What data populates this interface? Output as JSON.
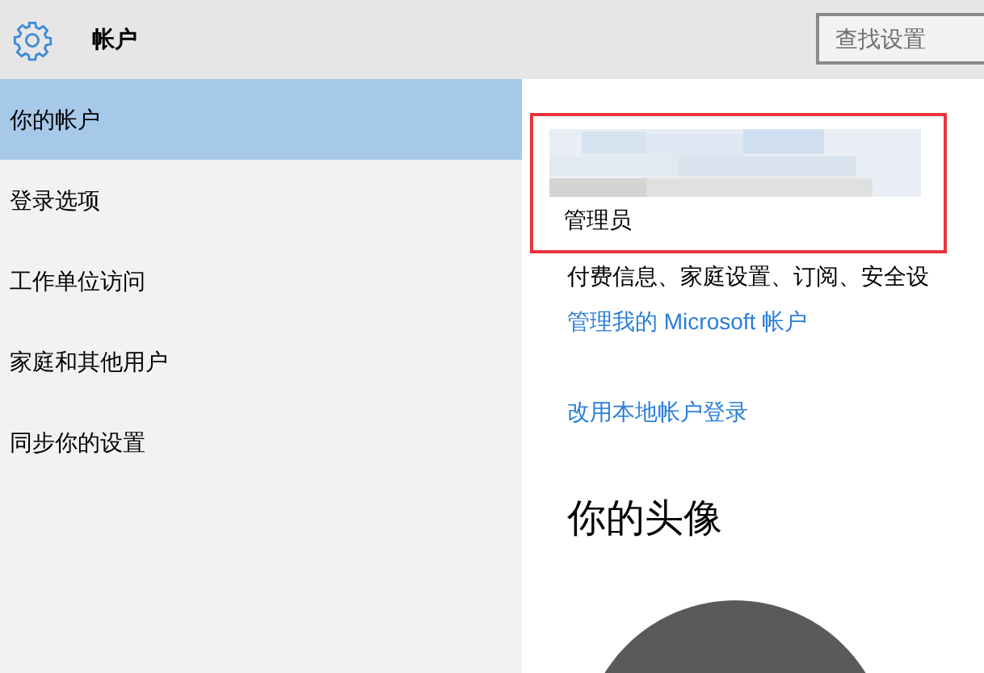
{
  "header": {
    "title": "帐户",
    "search": {
      "placeholder": "查找设置"
    }
  },
  "sidebar": {
    "items": [
      {
        "label": "你的帐户",
        "selected": true
      },
      {
        "label": "登录选项",
        "selected": false
      },
      {
        "label": "工作单位访问",
        "selected": false
      },
      {
        "label": "家庭和其他用户",
        "selected": false
      },
      {
        "label": "同步你的设置",
        "selected": false
      }
    ]
  },
  "account": {
    "highlighted": true,
    "role": "管理员"
  },
  "content": {
    "description": "付费信息、家庭设置、订阅、安全设",
    "links": [
      "管理我的 Microsoft 帐户",
      "改用本地帐户登录"
    ],
    "avatar_heading": "你的头像"
  }
}
